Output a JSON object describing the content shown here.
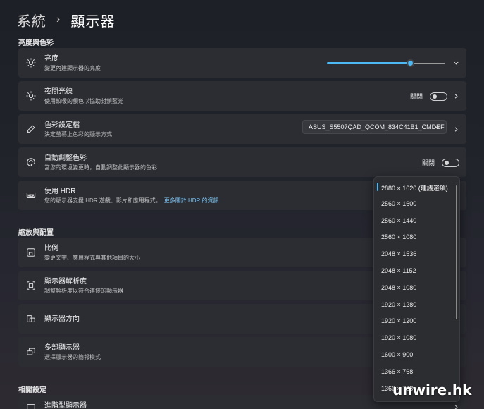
{
  "breadcrumb": {
    "parent": "系統",
    "separator": "›",
    "current": "顯示器"
  },
  "sections": {
    "brightness_color": "亮度與色彩",
    "scale_layout": "縮放與配置",
    "related": "相關設定"
  },
  "brightness": {
    "title": "亮度",
    "subtitle": "變更內建顯示器的亮度",
    "level_percent": 70
  },
  "night_light": {
    "title": "夜間光線",
    "subtitle": "使用較暖的顏色以協助封鎖藍光",
    "state": "關閉"
  },
  "color_profile": {
    "title": "色彩設定檔",
    "subtitle": "決定螢幕上色彩的顯示方式",
    "selected": "ASUS_S5507QAD_QCOM_834C41B1_CMDEF"
  },
  "auto_color": {
    "title": "自動調整色彩",
    "subtitle": "當您的環境變更時，自動調整此顯示器的色彩",
    "state": "關閉"
  },
  "hdr": {
    "title": "使用 HDR",
    "subtitle": "您的顯示器支援 HDR 遊戲、影片和應用程式。",
    "link": "更多關於 HDR 的資訊"
  },
  "scale": {
    "title": "比例",
    "subtitle": "變更文字、應用程式與其他項目的大小"
  },
  "resolution": {
    "title": "顯示器解析度",
    "subtitle": "調整解析度以符合連接的顯示器"
  },
  "orientation": {
    "title": "顯示器方向"
  },
  "multi_display": {
    "title": "多部顯示器",
    "subtitle": "選擇顯示器的簡報模式"
  },
  "advanced": {
    "title": "進階型顯示器"
  },
  "resolution_options": [
    "2880 × 1620 (建議選項)",
    "2560 × 1600",
    "2560 × 1440",
    "2560 × 1080",
    "2048 × 1536",
    "2048 × 1152",
    "2048 × 1080",
    "1920 × 1280",
    "1920 × 1200",
    "1920 × 1080",
    "1600 × 900",
    "1366 × 768",
    "1360 × 768"
  ],
  "watermark": "unwire.hk",
  "colors": {
    "accent": "#4cb8f5",
    "card": "#2b2d33",
    "background": "#1e2027"
  },
  "icons": [
    "sun-icon",
    "night-light-icon",
    "color-dropper-icon",
    "palette-icon",
    "hdr-icon",
    "scale-icon",
    "resolution-icon",
    "orientation-icon",
    "multi-display-icon",
    "chevron-right-icon",
    "chevron-down-icon"
  ]
}
